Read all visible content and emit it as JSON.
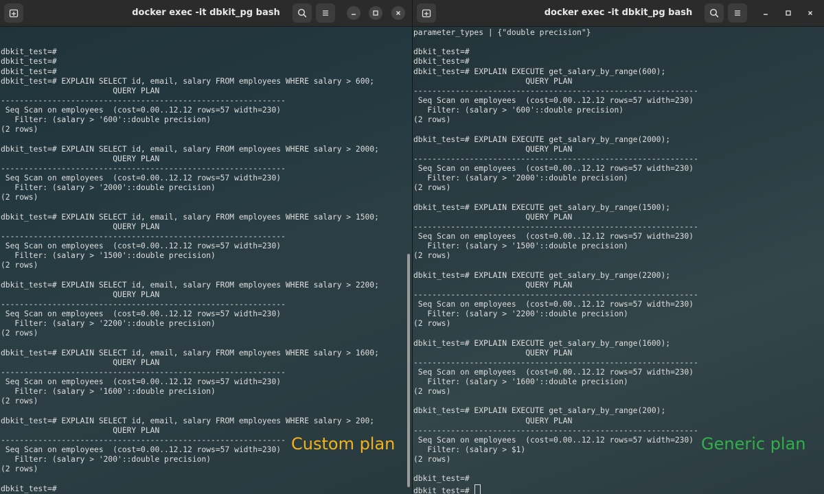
{
  "left_window": {
    "title": "docker exec -it dbkit_pg bash",
    "lines": [
      "",
      "",
      "dbkit_test=#",
      "dbkit_test=#",
      "dbkit_test=#",
      "dbkit_test=# EXPLAIN SELECT id, email, salary FROM employees WHERE salary > 600;",
      "                        QUERY PLAN",
      "-------------------------------------------------------------",
      " Seq Scan on employees  (cost=0.00..12.12 rows=57 width=230)",
      "   Filter: (salary > '600'::double precision)",
      "(2 rows)",
      "",
      "dbkit_test=# EXPLAIN SELECT id, email, salary FROM employees WHERE salary > 2000;",
      "                        QUERY PLAN",
      "-------------------------------------------------------------",
      " Seq Scan on employees  (cost=0.00..12.12 rows=57 width=230)",
      "   Filter: (salary > '2000'::double precision)",
      "(2 rows)",
      "",
      "dbkit_test=# EXPLAIN SELECT id, email, salary FROM employees WHERE salary > 1500;",
      "                        QUERY PLAN",
      "-------------------------------------------------------------",
      " Seq Scan on employees  (cost=0.00..12.12 rows=57 width=230)",
      "   Filter: (salary > '1500'::double precision)",
      "(2 rows)",
      "",
      "dbkit_test=# EXPLAIN SELECT id, email, salary FROM employees WHERE salary > 2200;",
      "                        QUERY PLAN",
      "-------------------------------------------------------------",
      " Seq Scan on employees  (cost=0.00..12.12 rows=57 width=230)",
      "   Filter: (salary > '2200'::double precision)",
      "(2 rows)",
      "",
      "dbkit_test=# EXPLAIN SELECT id, email, salary FROM employees WHERE salary > 1600;",
      "                        QUERY PLAN",
      "-------------------------------------------------------------",
      " Seq Scan on employees  (cost=0.00..12.12 rows=57 width=230)",
      "   Filter: (salary > '1600'::double precision)",
      "(2 rows)",
      "",
      "dbkit_test=# EXPLAIN SELECT id, email, salary FROM employees WHERE salary > 200;",
      "                        QUERY PLAN",
      "-------------------------------------------------------------",
      " Seq Scan on employees  (cost=0.00..12.12 rows=57 width=230)",
      "   Filter: (salary > '200'::double precision)",
      "(2 rows)",
      "",
      "dbkit_test=#"
    ],
    "annotation": "Custom plan",
    "annotation_color": "#f2b21c"
  },
  "right_window": {
    "title": "docker exec -it dbkit_pg bash",
    "lines": [
      "parameter_types | {\"double precision\"}",
      "",
      "dbkit_test=#",
      "dbkit_test=#",
      "dbkit_test=# EXPLAIN EXECUTE get_salary_by_range(600);",
      "                        QUERY PLAN",
      "-------------------------------------------------------------",
      " Seq Scan on employees  (cost=0.00..12.12 rows=57 width=230)",
      "   Filter: (salary > '600'::double precision)",
      "(2 rows)",
      "",
      "dbkit_test=# EXPLAIN EXECUTE get_salary_by_range(2000);",
      "                        QUERY PLAN",
      "-------------------------------------------------------------",
      " Seq Scan on employees  (cost=0.00..12.12 rows=57 width=230)",
      "   Filter: (salary > '2000'::double precision)",
      "(2 rows)",
      "",
      "dbkit_test=# EXPLAIN EXECUTE get_salary_by_range(1500);",
      "                        QUERY PLAN",
      "-------------------------------------------------------------",
      " Seq Scan on employees  (cost=0.00..12.12 rows=57 width=230)",
      "   Filter: (salary > '1500'::double precision)",
      "(2 rows)",
      "",
      "dbkit_test=# EXPLAIN EXECUTE get_salary_by_range(2200);",
      "                        QUERY PLAN",
      "-------------------------------------------------------------",
      " Seq Scan on employees  (cost=0.00..12.12 rows=57 width=230)",
      "   Filter: (salary > '2200'::double precision)",
      "(2 rows)",
      "",
      "dbkit_test=# EXPLAIN EXECUTE get_salary_by_range(1600);",
      "                        QUERY PLAN",
      "-------------------------------------------------------------",
      " Seq Scan on employees  (cost=0.00..12.12 rows=57 width=230)",
      "   Filter: (salary > '1600'::double precision)",
      "(2 rows)",
      "",
      "dbkit_test=# EXPLAIN EXECUTE get_salary_by_range(200);",
      "                        QUERY PLAN",
      "-------------------------------------------------------------",
      " Seq Scan on employees  (cost=0.00..12.12 rows=57 width=230)",
      "   Filter: (salary > $1)",
      "(2 rows)",
      "",
      "dbkit_test=#"
    ],
    "prompt_line": "dbkit_test=# ",
    "annotation": "Generic plan",
    "annotation_color": "#2fb04a"
  },
  "icons": {
    "new_tab": "new-tab-icon",
    "search": "search-icon",
    "menu": "hamburger-menu-icon",
    "minimize": "minimize-icon",
    "maximize": "maximize-icon",
    "close": "close-icon"
  }
}
